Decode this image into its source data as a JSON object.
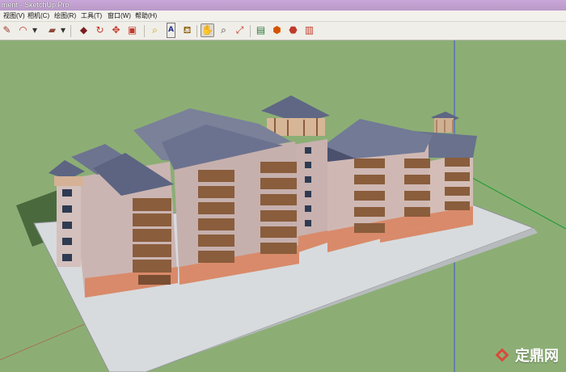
{
  "app": {
    "title": "ment - SketchUp Pro"
  },
  "menu": {
    "items": [
      "视图(V)",
      "相机(C)",
      "绘图(R)",
      "工具(T)",
      "窗口(W)",
      "帮助(H)"
    ]
  },
  "toolbar": {
    "buttons": [
      {
        "icon": "pencil-icon",
        "glyph": "✎",
        "color": "#9b3b2c"
      },
      {
        "icon": "arc-icon",
        "glyph": "◠",
        "color": "#c0392b"
      },
      {
        "icon": "dropdown-icon",
        "glyph": "▾",
        "color": "#333333"
      },
      {
        "icon": "rectangle-icon",
        "glyph": "▰",
        "color": "#8d4c3c"
      },
      {
        "icon": "dropdown-icon",
        "glyph": "▾",
        "color": "#333333"
      },
      {
        "icon": "push-pull-icon",
        "glyph": "◆",
        "color": "#7a1f1f"
      },
      {
        "icon": "follow-me-icon",
        "glyph": "↻",
        "color": "#c0392b"
      },
      {
        "icon": "move-icon",
        "glyph": "✥",
        "color": "#c0392b"
      },
      {
        "icon": "scale-icon",
        "glyph": "▣",
        "color": "#c0392b"
      },
      {
        "icon": "tape-measure-icon",
        "glyph": "⌕",
        "color": "#c6a200"
      },
      {
        "icon": "text-icon",
        "glyph": "A",
        "color": "#1f2f8a"
      },
      {
        "icon": "paint-bucket-icon",
        "glyph": "⛾",
        "color": "#8a5a00"
      },
      {
        "icon": "orbit-icon",
        "glyph": "✋",
        "color": "#333333"
      },
      {
        "icon": "zoom-icon",
        "glyph": "⌕",
        "color": "#333333"
      },
      {
        "icon": "zoom-extents-icon",
        "glyph": "⤢",
        "color": "#c0392b"
      },
      {
        "icon": "components-icon",
        "glyph": "▤",
        "color": "#2c7a3c"
      },
      {
        "icon": "layers-icon",
        "glyph": "⬢",
        "color": "#d35400"
      },
      {
        "icon": "materials-icon",
        "glyph": "⬣",
        "color": "#c0392b"
      },
      {
        "icon": "scenes-icon",
        "glyph": "▥",
        "color": "#c0392b"
      }
    ]
  },
  "watermark": {
    "label": "定鼎网"
  },
  "colors": {
    "titlebar": "#c1a1d1",
    "ground": "#8cae75",
    "slab": "#d9dcdf",
    "wall": "#c9b3b0",
    "wall_dark": "#9f8a89",
    "base": "#d98a6a",
    "roof": "#6e7591",
    "roof_dark": "#4d5270",
    "window_dark": "#2d3950",
    "balcony": "#8a5d3c"
  }
}
